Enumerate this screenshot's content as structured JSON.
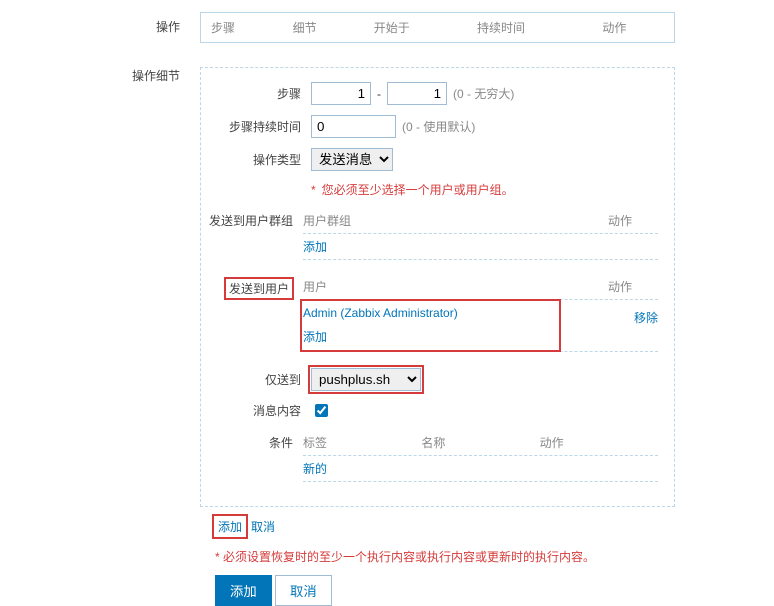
{
  "labels": {
    "operations": "操作",
    "op_details": "操作细节",
    "steps": "步骤",
    "step_duration": "步骤持续时间",
    "op_type": "操作类型",
    "send_to_groups": "发送到用户群组",
    "send_to_users": "发送到用户",
    "only_send_to": "仅送到",
    "msg_content": "消息内容",
    "conditions": "条件"
  },
  "ops_header": {
    "step": "步骤",
    "detail": "细节",
    "start_in": "开始于",
    "duration": "持续时间",
    "action": "动作"
  },
  "form": {
    "step_from": "1",
    "step_dash": "-",
    "step_to": "1",
    "step_hint": "(0 - 无穷大)",
    "duration_val": "0",
    "duration_hint": "(0 - 使用默认)",
    "op_type_val": "发送消息",
    "op_type_warn": "您必须至少选择一个用户或用户组。",
    "only_send_val": "pushplus.sh"
  },
  "groups": {
    "header_name": "用户群组",
    "header_action": "动作",
    "add": "添加"
  },
  "users": {
    "header_name": "用户",
    "header_action": "动作",
    "rows": [
      {
        "name": "Admin (Zabbix Administrator)",
        "remove": "移除"
      }
    ],
    "add": "添加"
  },
  "conditions_tbl": {
    "label": "标签",
    "name": "名称",
    "action": "动作",
    "new": "新的"
  },
  "links": {
    "add": "添加",
    "cancel": "取消"
  },
  "bottom": {
    "recovery_hint": "必须设置恢复时的至少一个执行内容或执行内容或更新时的执行内容。",
    "add_btn": "添加",
    "cancel_btn": "取消"
  }
}
